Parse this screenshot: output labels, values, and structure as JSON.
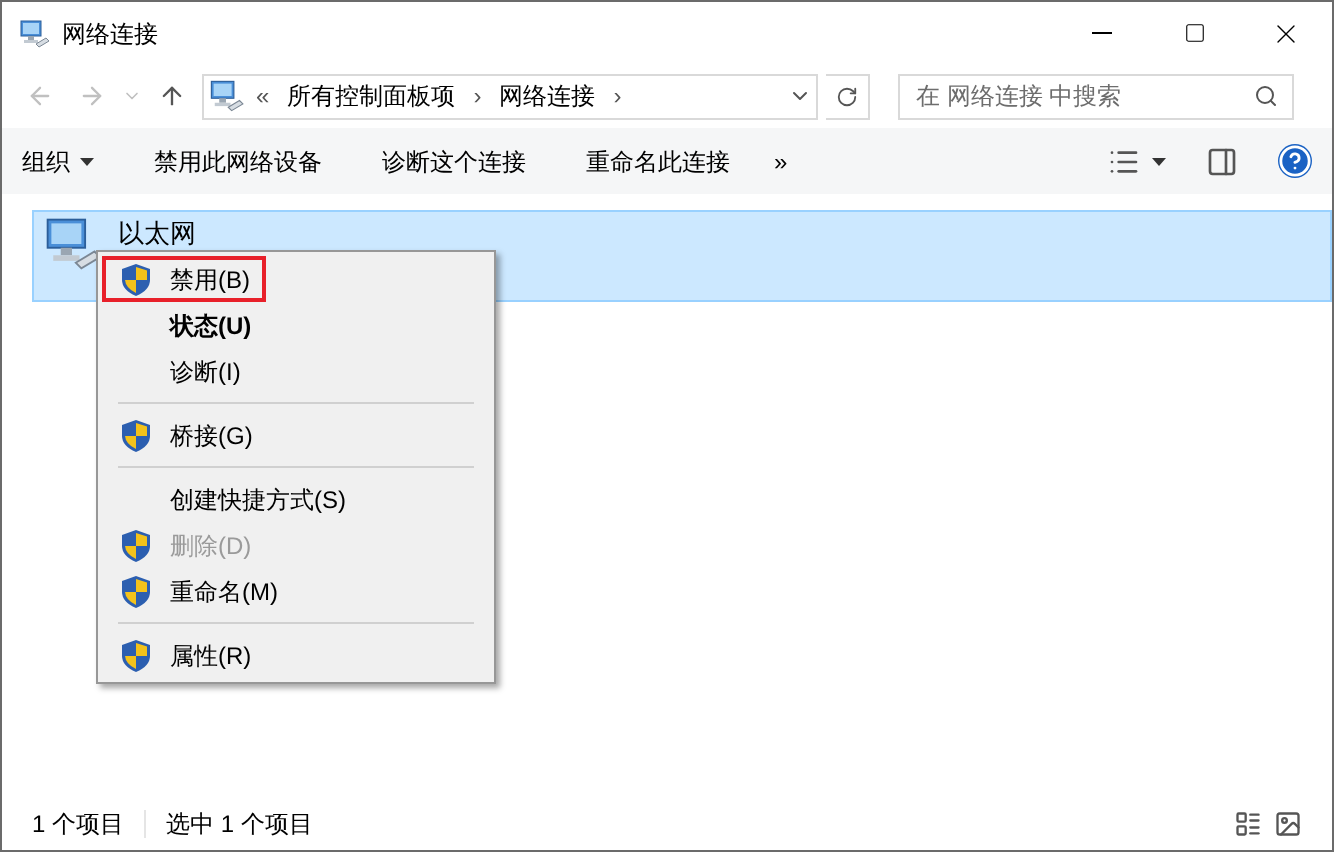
{
  "window": {
    "title": "网络连接"
  },
  "address": {
    "prefix": "«",
    "crumbs": [
      "所有控制面板项",
      "网络连接"
    ],
    "separator": "›"
  },
  "search": {
    "placeholder": "在 网络连接 中搜索"
  },
  "toolbar": {
    "items": [
      {
        "label": "组织",
        "dropdown": true
      },
      {
        "label": "禁用此网络设备",
        "dropdown": false
      },
      {
        "label": "诊断这个连接",
        "dropdown": false
      },
      {
        "label": "重命名此连接",
        "dropdown": false
      }
    ],
    "more": "»"
  },
  "items": [
    {
      "name": "以太网",
      "selected": true
    }
  ],
  "context_menu": [
    {
      "kind": "item",
      "label": "禁用(B)",
      "shield": true,
      "bold": false,
      "disabled": false,
      "highlighted": true
    },
    {
      "kind": "item",
      "label": "状态(U)",
      "shield": false,
      "bold": true,
      "disabled": false,
      "highlighted": false
    },
    {
      "kind": "item",
      "label": "诊断(I)",
      "shield": false,
      "bold": false,
      "disabled": false,
      "highlighted": false
    },
    {
      "kind": "separator"
    },
    {
      "kind": "item",
      "label": "桥接(G)",
      "shield": true,
      "bold": false,
      "disabled": false,
      "highlighted": false
    },
    {
      "kind": "separator"
    },
    {
      "kind": "item",
      "label": "创建快捷方式(S)",
      "shield": false,
      "bold": false,
      "disabled": false,
      "highlighted": false
    },
    {
      "kind": "item",
      "label": "删除(D)",
      "shield": true,
      "bold": false,
      "disabled": true,
      "highlighted": false
    },
    {
      "kind": "item",
      "label": "重命名(M)",
      "shield": true,
      "bold": false,
      "disabled": false,
      "highlighted": false
    },
    {
      "kind": "separator"
    },
    {
      "kind": "item",
      "label": "属性(R)",
      "shield": true,
      "bold": false,
      "disabled": false,
      "highlighted": false
    }
  ],
  "status_bar": {
    "count": "1 个项目",
    "selection": "选中 1 个项目"
  }
}
